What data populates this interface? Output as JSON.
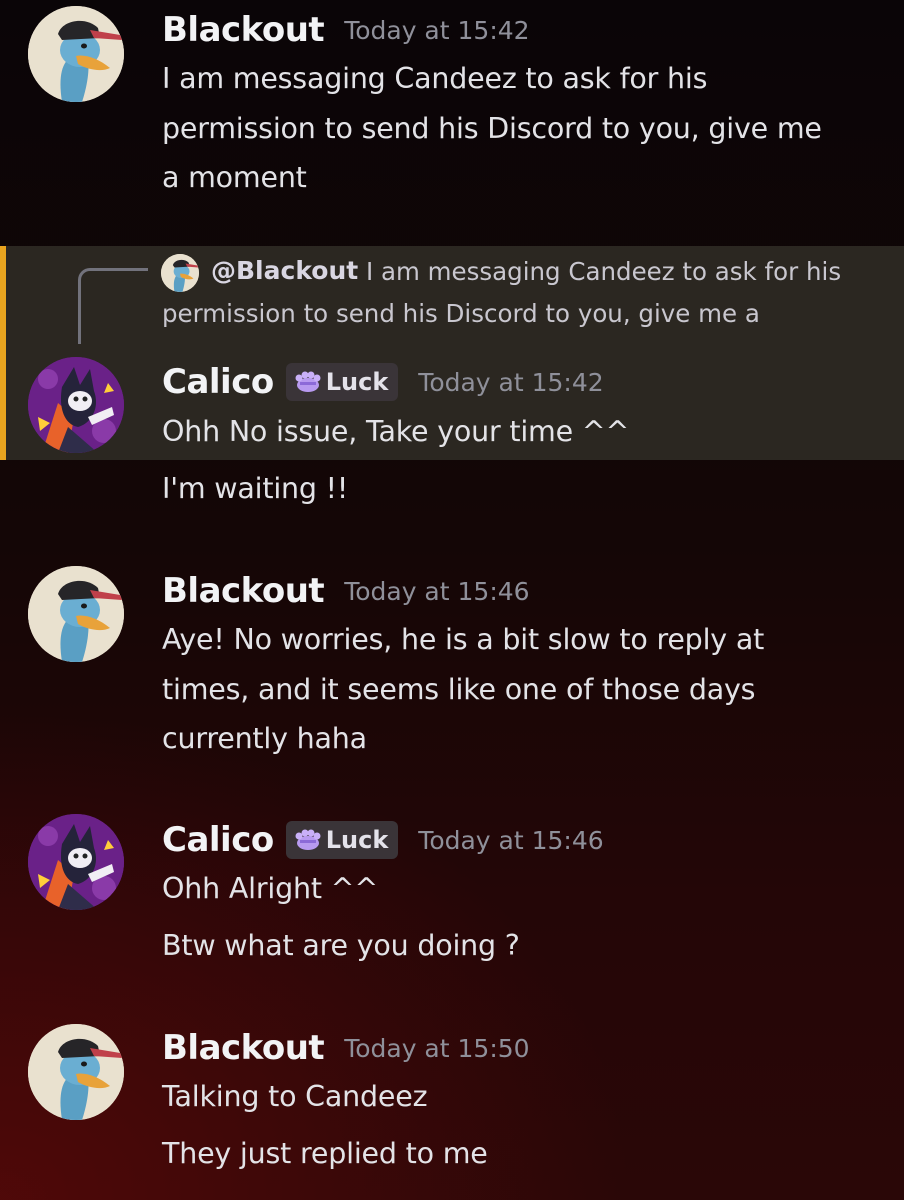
{
  "colors": {
    "background": "#140606",
    "highlight": "#2b2721",
    "mention_bar": "#e8a41f",
    "username": "#f2f3f5",
    "timestamp": "#8f909a"
  },
  "reply_preview": {
    "author": "@Blackout",
    "text_line1": "I am messaging Candeez to ask for his",
    "text_line2": "permission to send his Discord to you, give me a"
  },
  "messages": [
    {
      "username": "Blackout",
      "avatar_icon": "duck-avatar",
      "timestamp": "Today at 15:42",
      "lines": [
        "I am messaging Candeez to ask for his",
        "permission to send his Discord to you, give me",
        "a moment"
      ]
    },
    {
      "username": "Calico",
      "avatar_icon": "cat-avatar",
      "badge": "Luck",
      "badge_icon": "paw-icon",
      "timestamp": "Today at 15:42",
      "lines": [
        "Ohh No issue, Take your time ^^"
      ],
      "followups": [
        "I'm waiting !!"
      ]
    },
    {
      "username": "Blackout",
      "avatar_icon": "duck-avatar",
      "timestamp": "Today at 15:46",
      "lines": [
        "Aye! No worries, he is a bit slow to reply at",
        "times, and it seems like one of those days",
        "currently haha"
      ]
    },
    {
      "username": "Calico",
      "avatar_icon": "cat-avatar",
      "badge": "Luck",
      "badge_icon": "paw-icon",
      "timestamp": "Today at 15:46",
      "lines": [
        "Ohh Alright ^^"
      ],
      "followups": [
        "Btw what are you doing ?"
      ]
    },
    {
      "username": "Blackout",
      "avatar_icon": "duck-avatar",
      "timestamp": "Today at 15:50",
      "lines": [
        "Talking to Candeez"
      ],
      "followups": [
        "They just replied to me"
      ]
    }
  ]
}
